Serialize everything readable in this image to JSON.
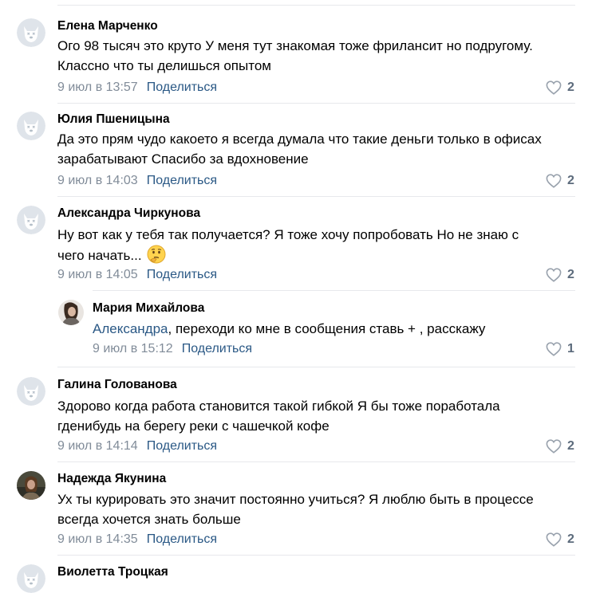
{
  "comments": [
    {
      "author": "Елена Марченко",
      "lines": [
        "Ого 98 тысяч это круто У меня тут знакомая тоже фрилансит но подругому.",
        "Классно что ты делишься опытом"
      ],
      "date": "9 июл в 13:57",
      "share": "Поделиться",
      "likes": "2",
      "avatar": "default-avatar"
    },
    {
      "author": "Юлия Пшеницына",
      "lines": [
        "Да это прям чудо какоето я всегда думала что такие деньги только в офисах",
        "зарабатывают Спасибо за вдохновение"
      ],
      "date": "9 июл в 14:03",
      "share": "Поделиться",
      "likes": "2",
      "avatar": "default-avatar"
    },
    {
      "author": "Александра Чиркунова",
      "lines": [
        "Ну вот как у тебя так получается? Я тоже хочу попробовать Но не знаю с",
        "чего начать..."
      ],
      "emoji": "thinking-face-emoji",
      "date": "9 июл в 14:05",
      "share": "Поделиться",
      "likes": "2",
      "avatar": "default-avatar"
    },
    {
      "author": "Мария Михайлова",
      "mention": "Александра",
      "text_after_mention": ", переходи ко мне в сообщения ставь + , расскажу",
      "date": "9 июл в 15:12",
      "share": "Поделиться",
      "likes": "1",
      "avatar": "photo-avatar",
      "reply": true
    },
    {
      "author": "Галина Голованова",
      "lines": [
        "Здорово когда работа становится такой гибкой Я бы тоже поработала",
        "гденибудь на берегу реки с чашечкой кофе"
      ],
      "date": "9 июл в 14:14",
      "share": "Поделиться",
      "likes": "2",
      "avatar": "default-avatar"
    },
    {
      "author": "Надежда Якунина",
      "lines": [
        "Ух ты курировать это значит постоянно учиться? Я люблю быть в процессе",
        "всегда хочется знать больше"
      ],
      "date": "9 июл в 14:35",
      "share": "Поделиться",
      "likes": "2",
      "avatar": "photo-avatar"
    },
    {
      "author": "Виолетта Троцкая",
      "avatar": "default-avatar"
    }
  ],
  "colors": {
    "link": "#2a5885",
    "meta": "#818c99",
    "like": "#5c6b7c",
    "separator": "#e7e8ec",
    "avatar_bg": "#dfe4ea"
  }
}
